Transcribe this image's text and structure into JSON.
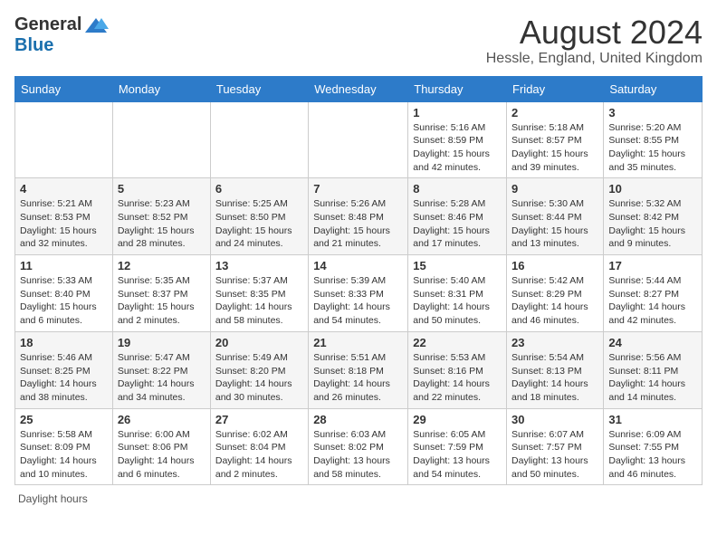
{
  "header": {
    "logo_general": "General",
    "logo_blue": "Blue",
    "month_year": "August 2024",
    "location": "Hessle, England, United Kingdom"
  },
  "weekdays": [
    "Sunday",
    "Monday",
    "Tuesday",
    "Wednesday",
    "Thursday",
    "Friday",
    "Saturday"
  ],
  "weeks": [
    [
      {
        "day": "",
        "info": ""
      },
      {
        "day": "",
        "info": ""
      },
      {
        "day": "",
        "info": ""
      },
      {
        "day": "",
        "info": ""
      },
      {
        "day": "1",
        "info": "Sunrise: 5:16 AM\nSunset: 8:59 PM\nDaylight: 15 hours and 42 minutes."
      },
      {
        "day": "2",
        "info": "Sunrise: 5:18 AM\nSunset: 8:57 PM\nDaylight: 15 hours and 39 minutes."
      },
      {
        "day": "3",
        "info": "Sunrise: 5:20 AM\nSunset: 8:55 PM\nDaylight: 15 hours and 35 minutes."
      }
    ],
    [
      {
        "day": "4",
        "info": "Sunrise: 5:21 AM\nSunset: 8:53 PM\nDaylight: 15 hours and 32 minutes."
      },
      {
        "day": "5",
        "info": "Sunrise: 5:23 AM\nSunset: 8:52 PM\nDaylight: 15 hours and 28 minutes."
      },
      {
        "day": "6",
        "info": "Sunrise: 5:25 AM\nSunset: 8:50 PM\nDaylight: 15 hours and 24 minutes."
      },
      {
        "day": "7",
        "info": "Sunrise: 5:26 AM\nSunset: 8:48 PM\nDaylight: 15 hours and 21 minutes."
      },
      {
        "day": "8",
        "info": "Sunrise: 5:28 AM\nSunset: 8:46 PM\nDaylight: 15 hours and 17 minutes."
      },
      {
        "day": "9",
        "info": "Sunrise: 5:30 AM\nSunset: 8:44 PM\nDaylight: 15 hours and 13 minutes."
      },
      {
        "day": "10",
        "info": "Sunrise: 5:32 AM\nSunset: 8:42 PM\nDaylight: 15 hours and 9 minutes."
      }
    ],
    [
      {
        "day": "11",
        "info": "Sunrise: 5:33 AM\nSunset: 8:40 PM\nDaylight: 15 hours and 6 minutes."
      },
      {
        "day": "12",
        "info": "Sunrise: 5:35 AM\nSunset: 8:37 PM\nDaylight: 15 hours and 2 minutes."
      },
      {
        "day": "13",
        "info": "Sunrise: 5:37 AM\nSunset: 8:35 PM\nDaylight: 14 hours and 58 minutes."
      },
      {
        "day": "14",
        "info": "Sunrise: 5:39 AM\nSunset: 8:33 PM\nDaylight: 14 hours and 54 minutes."
      },
      {
        "day": "15",
        "info": "Sunrise: 5:40 AM\nSunset: 8:31 PM\nDaylight: 14 hours and 50 minutes."
      },
      {
        "day": "16",
        "info": "Sunrise: 5:42 AM\nSunset: 8:29 PM\nDaylight: 14 hours and 46 minutes."
      },
      {
        "day": "17",
        "info": "Sunrise: 5:44 AM\nSunset: 8:27 PM\nDaylight: 14 hours and 42 minutes."
      }
    ],
    [
      {
        "day": "18",
        "info": "Sunrise: 5:46 AM\nSunset: 8:25 PM\nDaylight: 14 hours and 38 minutes."
      },
      {
        "day": "19",
        "info": "Sunrise: 5:47 AM\nSunset: 8:22 PM\nDaylight: 14 hours and 34 minutes."
      },
      {
        "day": "20",
        "info": "Sunrise: 5:49 AM\nSunset: 8:20 PM\nDaylight: 14 hours and 30 minutes."
      },
      {
        "day": "21",
        "info": "Sunrise: 5:51 AM\nSunset: 8:18 PM\nDaylight: 14 hours and 26 minutes."
      },
      {
        "day": "22",
        "info": "Sunrise: 5:53 AM\nSunset: 8:16 PM\nDaylight: 14 hours and 22 minutes."
      },
      {
        "day": "23",
        "info": "Sunrise: 5:54 AM\nSunset: 8:13 PM\nDaylight: 14 hours and 18 minutes."
      },
      {
        "day": "24",
        "info": "Sunrise: 5:56 AM\nSunset: 8:11 PM\nDaylight: 14 hours and 14 minutes."
      }
    ],
    [
      {
        "day": "25",
        "info": "Sunrise: 5:58 AM\nSunset: 8:09 PM\nDaylight: 14 hours and 10 minutes."
      },
      {
        "day": "26",
        "info": "Sunrise: 6:00 AM\nSunset: 8:06 PM\nDaylight: 14 hours and 6 minutes."
      },
      {
        "day": "27",
        "info": "Sunrise: 6:02 AM\nSunset: 8:04 PM\nDaylight: 14 hours and 2 minutes."
      },
      {
        "day": "28",
        "info": "Sunrise: 6:03 AM\nSunset: 8:02 PM\nDaylight: 13 hours and 58 minutes."
      },
      {
        "day": "29",
        "info": "Sunrise: 6:05 AM\nSunset: 7:59 PM\nDaylight: 13 hours and 54 minutes."
      },
      {
        "day": "30",
        "info": "Sunrise: 6:07 AM\nSunset: 7:57 PM\nDaylight: 13 hours and 50 minutes."
      },
      {
        "day": "31",
        "info": "Sunrise: 6:09 AM\nSunset: 7:55 PM\nDaylight: 13 hours and 46 minutes."
      }
    ]
  ],
  "footer": {
    "note": "Daylight hours"
  }
}
